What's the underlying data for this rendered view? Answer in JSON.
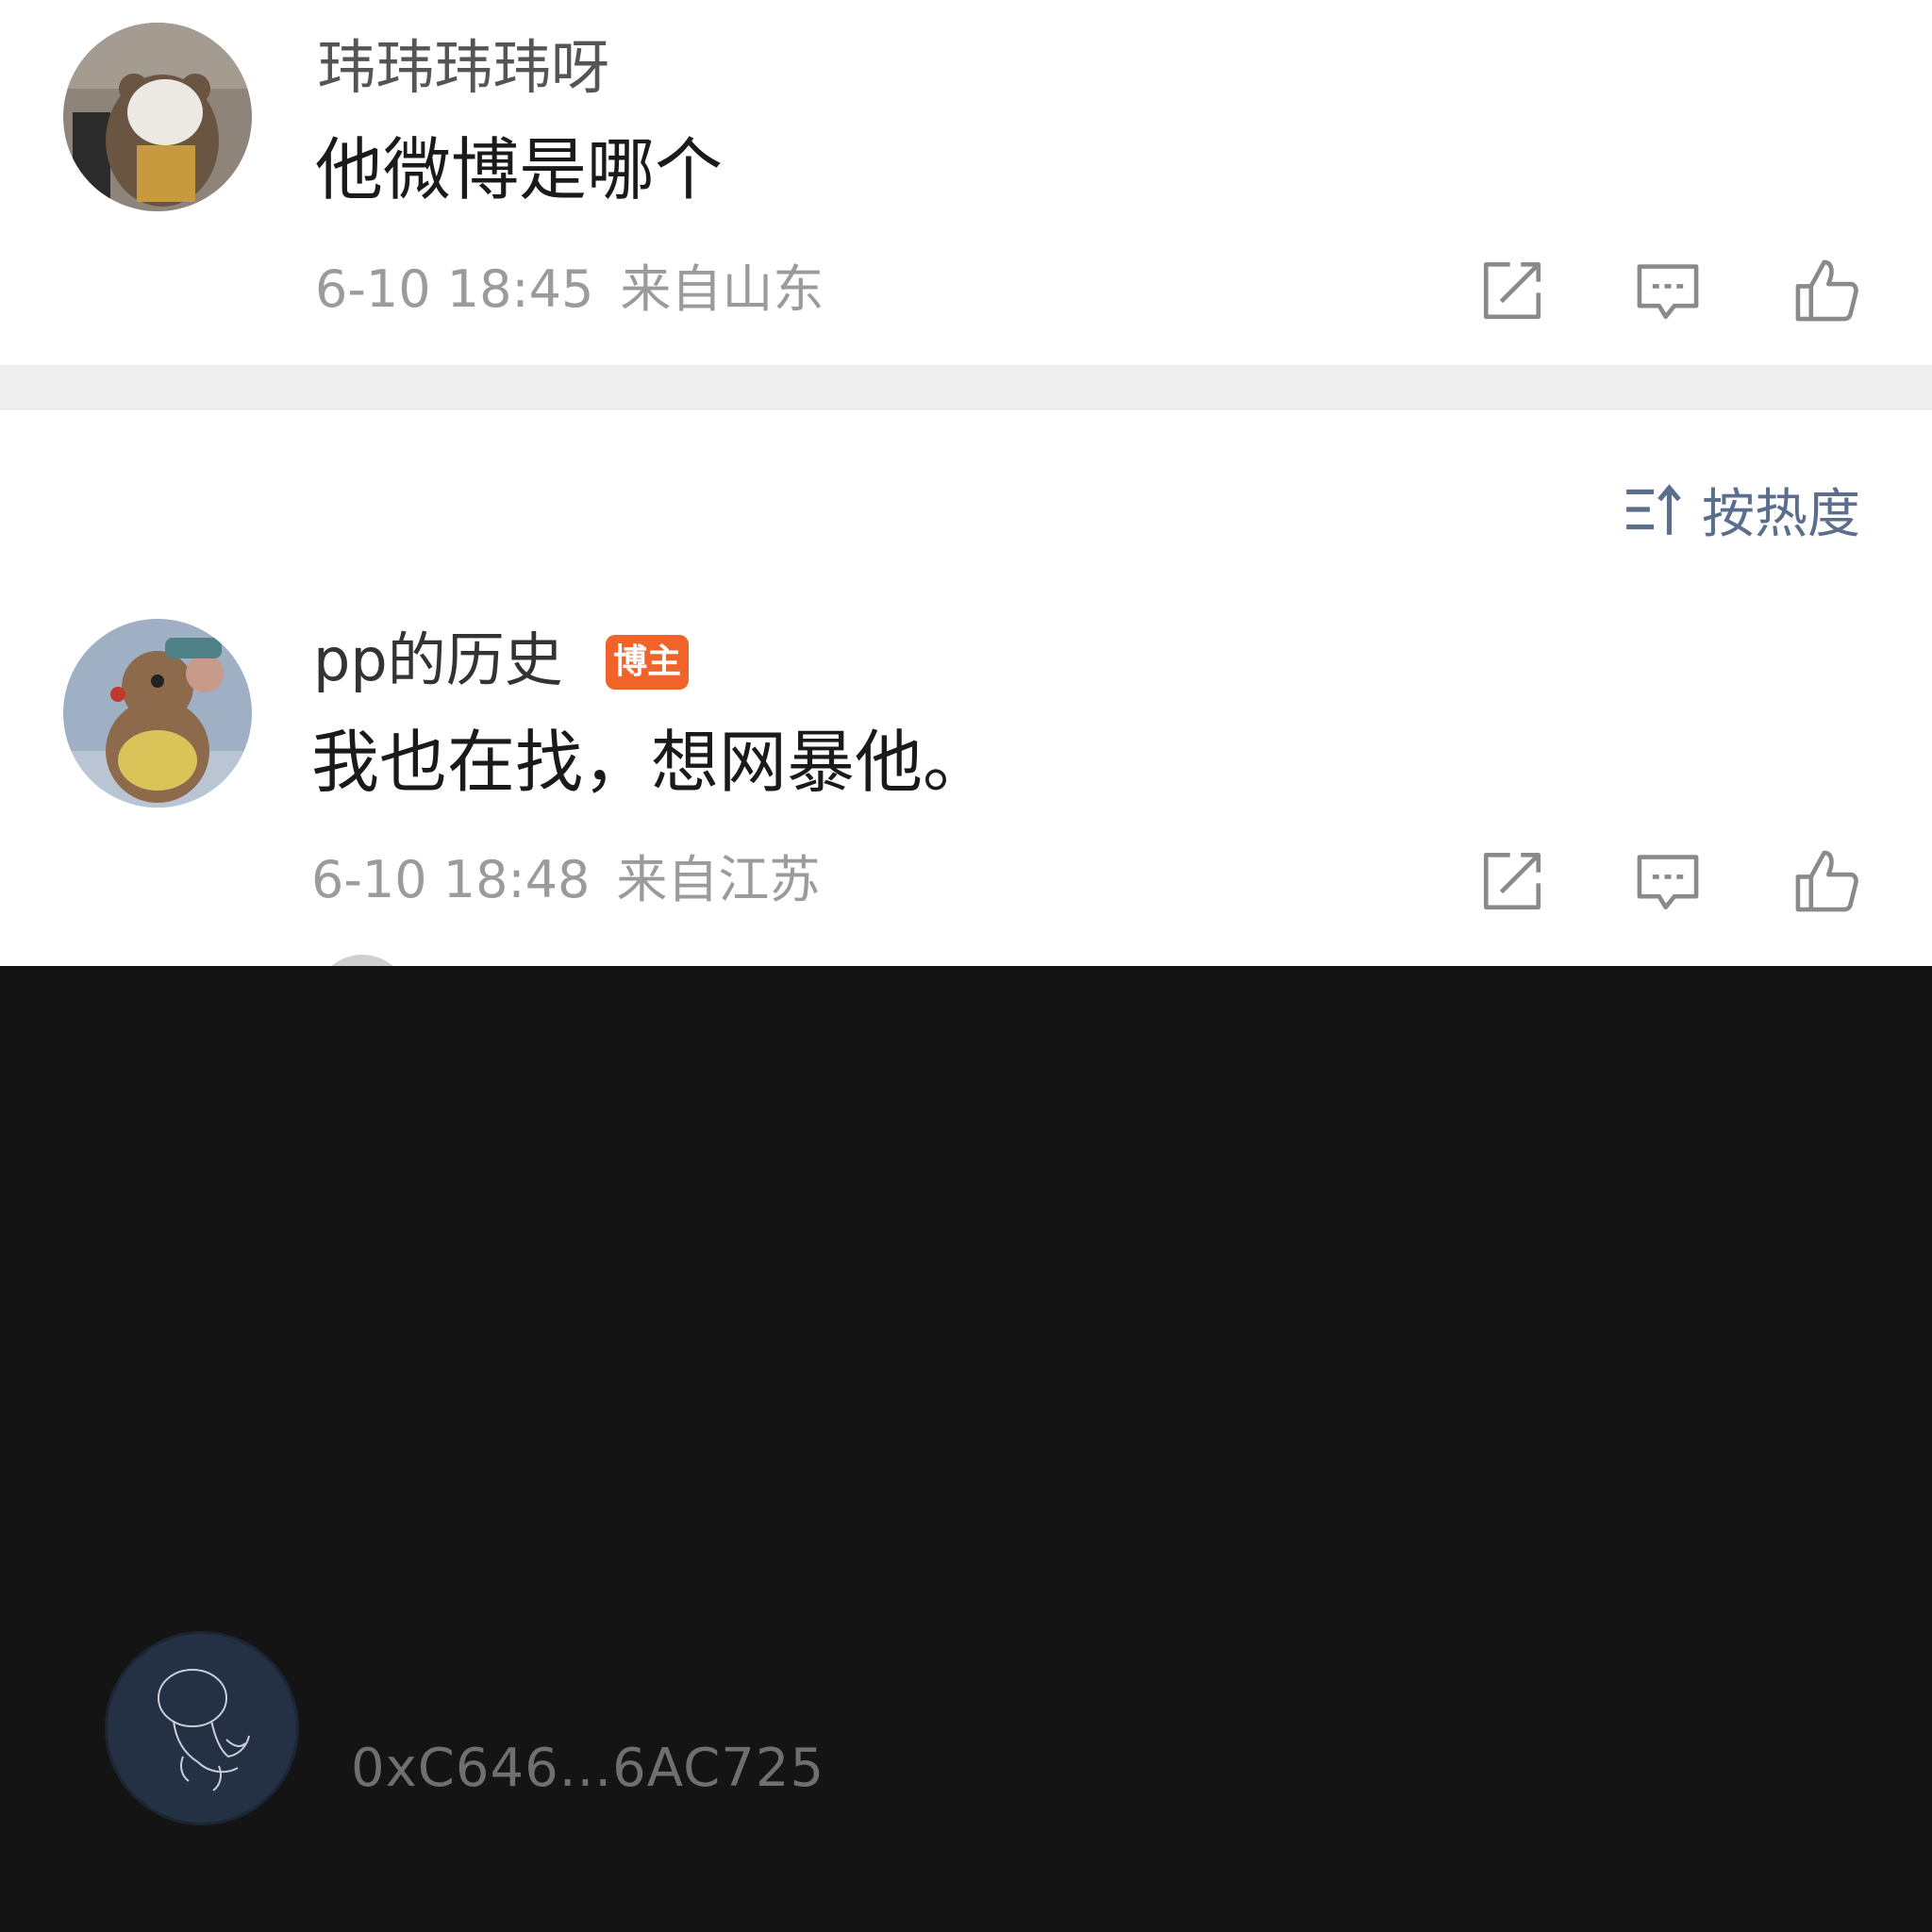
{
  "comments": [
    {
      "username": "玮玮玮玮呀",
      "text": "他微博是哪个",
      "time": "6-10 18:45",
      "location": "来自山东",
      "badge": ""
    },
    {
      "username": "pp的历史",
      "text": "我也在找，想网暴他。",
      "time": "6-10 18:48",
      "location": "来自江苏",
      "badge": "博主"
    }
  ],
  "sort": {
    "label": "按热度"
  },
  "icons": {
    "share": "share-icon",
    "reply": "comment-icon",
    "like": "thumbs-up-icon",
    "sort": "sort-icon"
  },
  "colors": {
    "badge": "#f0642a",
    "sort_text": "#5b6e8c",
    "footer_bg": "#141414",
    "meta_text": "#9b9b9b"
  },
  "wallet": {
    "address": "0xC646...6AC725"
  }
}
